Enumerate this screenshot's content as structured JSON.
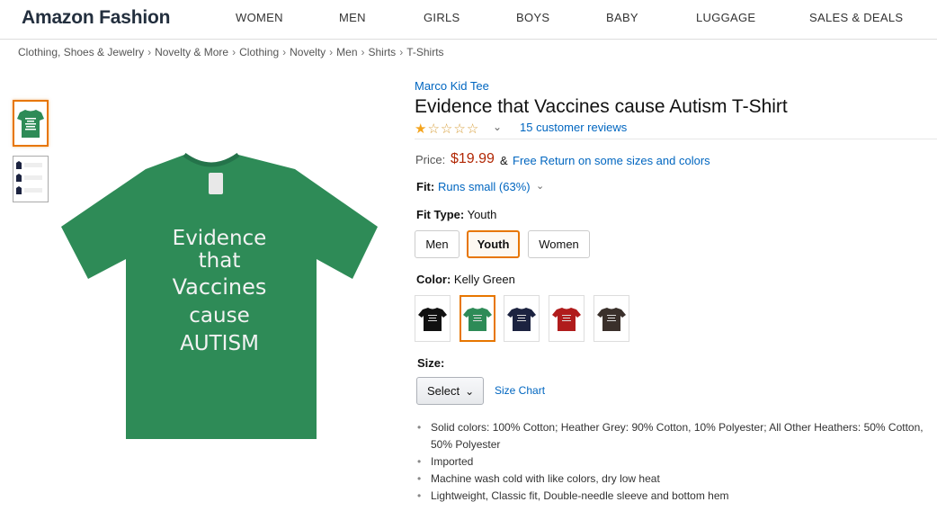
{
  "header": {
    "brand": "Amazon Fashion",
    "nav": [
      "WOMEN",
      "MEN",
      "GIRLS",
      "BOYS",
      "BABY",
      "LUGGAGE",
      "SALES & DEALS"
    ]
  },
  "breadcrumb": [
    "Clothing, Shoes & Jewelry",
    "Novelty & More",
    "Clothing",
    "Novelty",
    "Men",
    "Shirts",
    "T-Shirts"
  ],
  "product": {
    "brand_link": "Marco Kid Tee",
    "title": "Evidence that Vaccines cause Autism T-Shirt",
    "rating_stars": 1,
    "rating_max": 5,
    "reviews": "15 customer reviews",
    "price_label": "Price:",
    "price": "$19.99",
    "price_amp": "&",
    "free_return": "Free Return on some sizes and colors",
    "fit_label": "Fit:",
    "fit_value": "Runs small (63%)",
    "fit_type_label": "Fit Type:",
    "fit_type_value": "Youth",
    "fit_types": [
      "Men",
      "Youth",
      "Women"
    ],
    "color_label": "Color:",
    "color_value": "Kelly Green",
    "size_label": "Size:",
    "size_select": "Select",
    "size_chart": "Size Chart",
    "shirt_text": [
      "Evidence",
      "that",
      "Vaccines",
      "cause",
      "AUTISM"
    ],
    "features": [
      "Solid colors: 100% Cotton; Heather Grey: 90% Cotton, 10% Polyester; All Other Heathers: 50% Cotton, 50% Polyester",
      "Imported",
      "Machine wash cold with like colors, dry low heat",
      "Lightweight, Classic fit, Double-needle sleeve and bottom hem"
    ]
  },
  "colors": {
    "shirt_green": "#2e8b57",
    "swatches": [
      "#111111",
      "#2e8b57",
      "#1c2340",
      "#b01c1c",
      "#3a302b"
    ],
    "link": "#0066c0",
    "price": "#b12704",
    "accent": "#e77600"
  },
  "icons": [
    "star-filled-icon",
    "star-empty-icon",
    "chevron-down-icon"
  ]
}
